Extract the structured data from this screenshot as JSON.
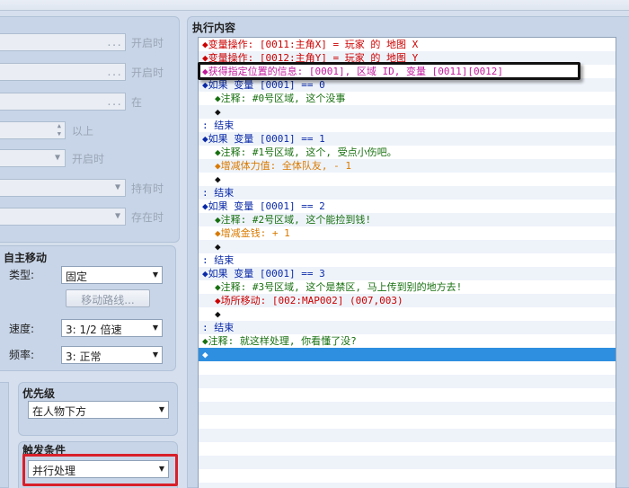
{
  "left_panel": {
    "rows": [
      {
        "label": "开启时",
        "value": "",
        "kind": "dots"
      },
      {
        "label": "开启时",
        "value": "",
        "kind": "dots"
      },
      {
        "label": "在",
        "value": "",
        "kind": "dots"
      },
      {
        "label": "以上",
        "value": "",
        "kind": "spin"
      },
      {
        "label": "开启时",
        "value": "",
        "kind": "combo"
      },
      {
        "label": "持有时",
        "value": "",
        "kind": "combo"
      },
      {
        "label": "存在时",
        "value": "",
        "kind": "combo"
      }
    ]
  },
  "auto_move": {
    "title": "自主移动",
    "type_label": "类型:",
    "type_value": "固定",
    "route_button": "移动路线...",
    "speed_label": "速度:",
    "speed_value": "3: 1/2 倍速",
    "freq_label": "频率:",
    "freq_value": "3: 正常"
  },
  "priority": {
    "title": "优先级",
    "value": "在人物下方"
  },
  "trigger": {
    "title": "触发条件",
    "value": "并行处理"
  },
  "contents": {
    "title": "执行内容",
    "lines": [
      {
        "indent": 0,
        "text": "◆变量操作: [0011:主角X] = 玩家 的 地图 X",
        "color": "red"
      },
      {
        "indent": 0,
        "text": "◆变量操作: [0012:主角Y] = 玩家 的 地图 Y",
        "color": "red"
      },
      {
        "indent": 0,
        "text": "◆获得指定位置的信息: [0001], 区域 ID, 变量 [0011][0012]",
        "color": "magenta"
      },
      {
        "indent": 0,
        "text": "◆如果 变量 [0001] == 0",
        "color": "blue"
      },
      {
        "indent": 1,
        "text": "◆注释: #0号区域, 这个没事",
        "color": "green"
      },
      {
        "indent": 1,
        "text": "◆",
        "color": "black"
      },
      {
        "indent": 0,
        "text": ": 结束",
        "color": "blue"
      },
      {
        "indent": 0,
        "text": "◆如果 变量 [0001] == 1",
        "color": "blue"
      },
      {
        "indent": 1,
        "text": "◆注释: #1号区域, 这个, 受点小伤吧。",
        "color": "green"
      },
      {
        "indent": 1,
        "text": "◆增减体力值: 全体队友, - 1",
        "color": "orange"
      },
      {
        "indent": 1,
        "text": "◆",
        "color": "black"
      },
      {
        "indent": 0,
        "text": ": 结束",
        "color": "blue"
      },
      {
        "indent": 0,
        "text": "◆如果 变量 [0001] == 2",
        "color": "blue"
      },
      {
        "indent": 1,
        "text": "◆注释: #2号区域, 这个能捡到钱!",
        "color": "green"
      },
      {
        "indent": 1,
        "text": "◆增减金钱: + 1",
        "color": "orange"
      },
      {
        "indent": 1,
        "text": "◆",
        "color": "black"
      },
      {
        "indent": 0,
        "text": ": 结束",
        "color": "blue"
      },
      {
        "indent": 0,
        "text": "◆如果 变量 [0001] == 3",
        "color": "blue"
      },
      {
        "indent": 1,
        "text": "◆注释: #3号区域, 这个是禁区, 马上传到别的地方去!",
        "color": "green"
      },
      {
        "indent": 1,
        "text": "◆场所移动: [002:MAP002] (007,003)",
        "color": "red"
      },
      {
        "indent": 1,
        "text": "◆",
        "color": "black"
      },
      {
        "indent": 0,
        "text": ": 结束",
        "color": "blue"
      },
      {
        "indent": 0,
        "text": "◆注释: 就这样处理, 你看懂了没?",
        "color": "green"
      },
      {
        "indent": 0,
        "text": "◆",
        "color": "sel"
      }
    ],
    "selected_index": 23
  },
  "colors": {
    "red": "#cc0000",
    "blue": "#0a2aa8",
    "green": "#17700f",
    "orange": "#d97a00",
    "magenta": "#c21a9c",
    "selection": "#2e8fe0",
    "highlight_red": "#d8202a"
  }
}
